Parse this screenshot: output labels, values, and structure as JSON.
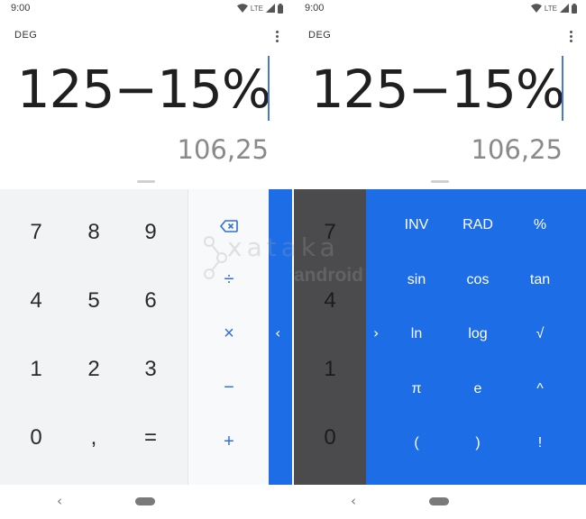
{
  "status_bar": {
    "time": "9:00",
    "network": "LTE",
    "icons": [
      "wifi-icon",
      "signal-icon",
      "battery-icon"
    ]
  },
  "calculator": {
    "angle_mode": "DEG",
    "formula": "125−15%",
    "result": "106,25"
  },
  "numpad": {
    "rows": [
      [
        "7",
        "8",
        "9"
      ],
      [
        "4",
        "5",
        "6"
      ],
      [
        "1",
        "2",
        "3"
      ],
      [
        "0",
        ",",
        "="
      ]
    ]
  },
  "operators": {
    "backspace_icon": "backspace-icon",
    "divide": "÷",
    "multiply": "×",
    "subtract": "−",
    "add": "+"
  },
  "advanced_panel": {
    "open_chevron": "‹",
    "close_chevron": "›",
    "functions": [
      [
        "INV",
        "RAD",
        "%"
      ],
      [
        "sin",
        "cos",
        "tan"
      ],
      [
        "ln",
        "log",
        "√"
      ],
      [
        "π",
        "e",
        "^"
      ],
      [
        "(",
        ")",
        "!"
      ]
    ]
  },
  "navigation": {
    "back": "‹",
    "home_icon": "home-pill-icon"
  },
  "watermark": {
    "brand": "xataka",
    "sub": "android"
  },
  "colors": {
    "accent": "#1d6de6",
    "operator_text": "#2f6fd6",
    "numpad_bg": "#f2f3f5",
    "overlay_dim": "#4b4b4d"
  }
}
